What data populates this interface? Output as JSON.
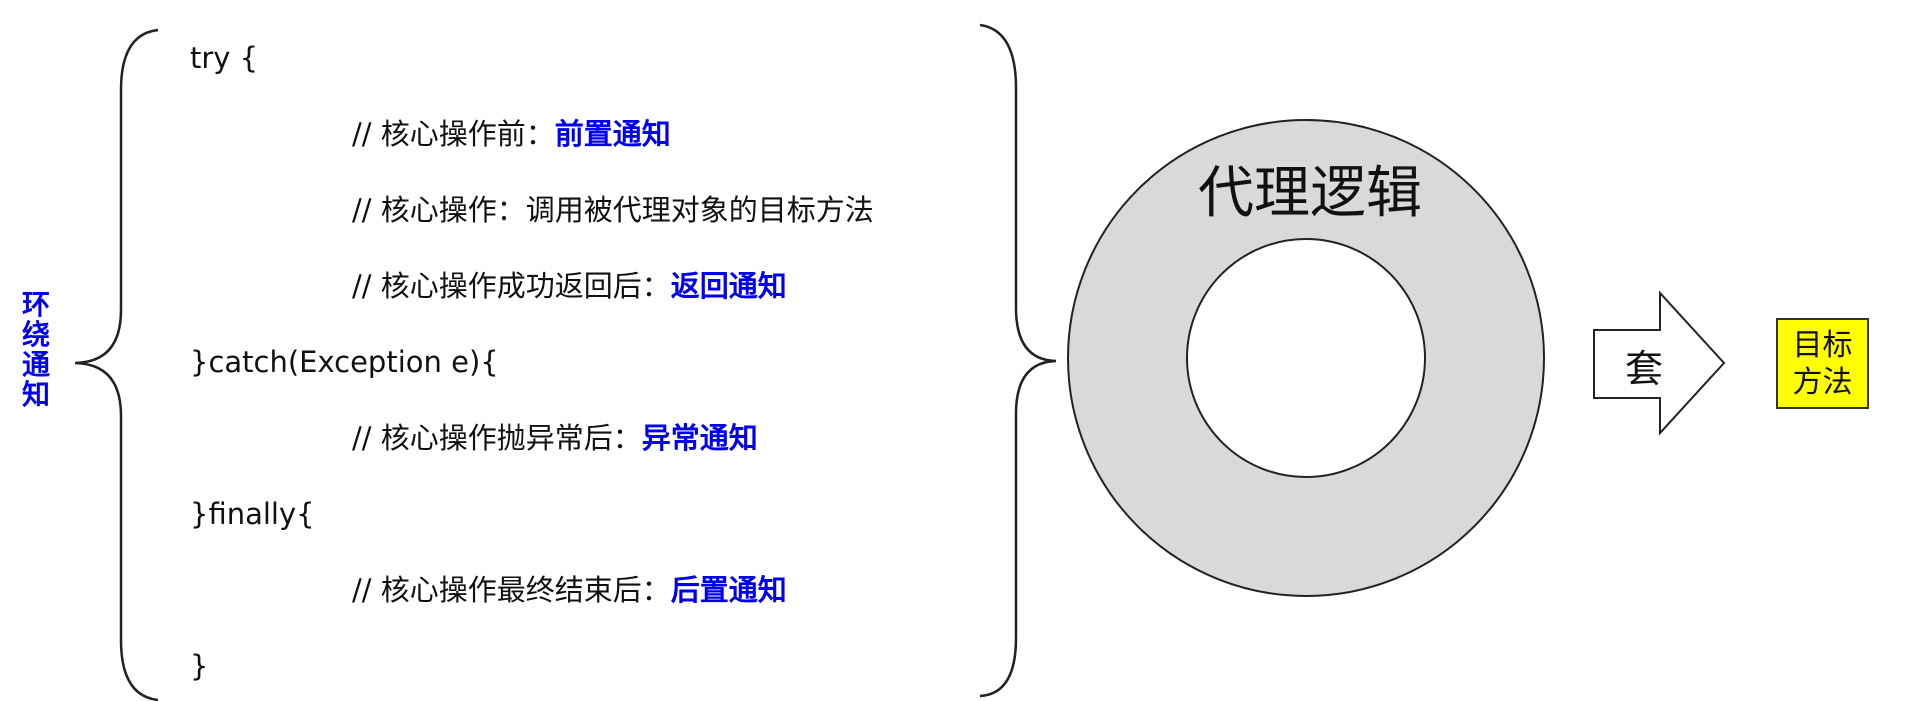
{
  "side_label": "环\n绕\n通\n知",
  "code": {
    "try_open": "try {",
    "before_comment": "// 核心操作前：",
    "before_advice": "前置通知",
    "core_comment": "// 核心操作：调用被代理对象的目标方法",
    "returning_comment": "// 核心操作成功返回后：",
    "returning_advice": "返回通知",
    "catch_line": "}catch(Exception e){",
    "throwing_comment": "// 核心操作抛异常后：",
    "throwing_advice": "异常通知",
    "finally_line": "}finally{",
    "after_comment": "// 核心操作最终结束后：",
    "after_advice": "后置通知",
    "close_brace": "}"
  },
  "ring": {
    "label": "代理逻辑",
    "fill_color": "#d9d9d9"
  },
  "arrow": {
    "label": "套"
  },
  "target": {
    "label": "目标\n方法",
    "fill_color": "#ffff00"
  },
  "colors": {
    "highlight": "#0000ee"
  }
}
